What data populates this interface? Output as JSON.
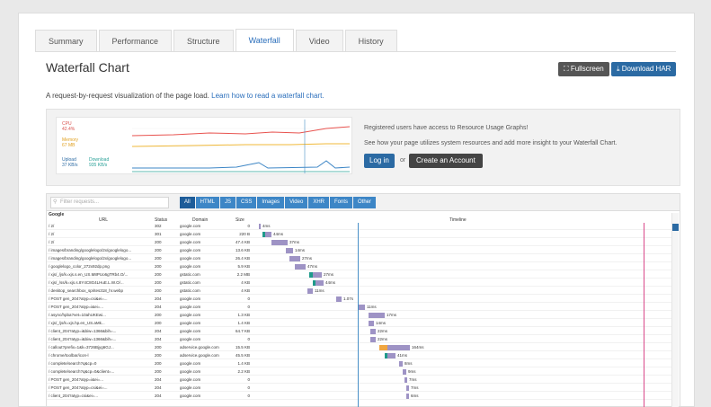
{
  "tabs": [
    {
      "label": "Summary",
      "active": false
    },
    {
      "label": "Performance",
      "active": false
    },
    {
      "label": "Structure",
      "active": false
    },
    {
      "label": "Waterfall",
      "active": true
    },
    {
      "label": "Video",
      "active": false
    },
    {
      "label": "History",
      "active": false
    }
  ],
  "header": {
    "title": "Waterfall Chart",
    "fullscreen_label": "⛶ Fullscreen",
    "download_label": "⤓ Download HAR",
    "subtitle": "A request-by-request visualization of the page load.",
    "subtitle_link": "Learn how to read a waterfall chart."
  },
  "usage_chart": {
    "cpu_label": "CPU",
    "cpu_value": "42.4%",
    "memory_label": "Memory",
    "memory_value": "67 MB",
    "upload_label": "Upload",
    "upload_value": "37 KB/s",
    "download_label": "Download",
    "download_value": "935 KB/s"
  },
  "promo": {
    "line1": "Registered users have access to Resource Usage Graphs!",
    "line2": "See how your page utilizes system resources and add more insight to your Waterfall Chart.",
    "login_label": "Log in",
    "or_label": "or",
    "create_label": "Create an Account"
  },
  "filter": {
    "placeholder": "Filter requests...",
    "chips": [
      "All",
      "HTML",
      "JS",
      "CSS",
      "Images",
      "Video",
      "XHR",
      "Fonts",
      "Other"
    ]
  },
  "table": {
    "group": "Google",
    "columns": {
      "url": "URL",
      "status": "Status",
      "domain": "Domain",
      "size": "Size",
      "timeline": "Timeline"
    },
    "rows": [
      {
        "url": "/ 2/",
        "status": "302",
        "domain": "google.com",
        "size": "0",
        "bar": "4ms"
      },
      {
        "url": "/ 2/",
        "status": "301",
        "domain": "google.com",
        "size": "220 B",
        "bar": "44ms"
      },
      {
        "url": "/ 2/",
        "status": "200",
        "domain": "google.com",
        "size": "47.4 KB",
        "bar": "37ms"
      },
      {
        "url": "/ images/branding/googlelogo/2x/googlelogo...",
        "status": "200",
        "domain": "google.com",
        "size": "13.6 KB",
        "bar": "14ms"
      },
      {
        "url": "/ images/branding/googlelogo/2x/googlelogo...",
        "status": "200",
        "domain": "google.com",
        "size": "26.4 KB",
        "bar": "27ms"
      },
      {
        "url": "/ googlelogo_color_272x92dp.png",
        "status": "200",
        "domain": "google.com",
        "size": "5.9 KB",
        "bar": "47ms"
      },
      {
        "url": "/ xjs/_/js/k=xjs.s.en_US.M8PUo6gTRb4.O/...",
        "status": "200",
        "domain": "gstatic.com",
        "size": "2.2 MB",
        "bar": "27ms"
      },
      {
        "url": "/ xjs/_/ss/k=xjs.s.8Y4C8G4LHuE.L.W.O/...",
        "status": "200",
        "domain": "gstatic.com",
        "size": "4 KB",
        "bar": "44ms"
      },
      {
        "url": "/ desktop_searchbox_sprites318_hr.webp",
        "status": "200",
        "domain": "gstatic.com",
        "size": "4 KB",
        "bar": "11ms"
      },
      {
        "url": "/ POST gen_204?atyp=csi&ei=...",
        "status": "204",
        "domain": "google.com",
        "size": "0",
        "bar": "1.07s"
      },
      {
        "url": "/ POST gen_204?atyp=i&ei=...",
        "status": "204",
        "domain": "google.com",
        "size": "0",
        "bar": "11ms"
      },
      {
        "url": "/ async/hpba?vet=10ahUKEwi...",
        "status": "200",
        "domain": "google.com",
        "size": "1.3 KB",
        "bar": "17ms"
      },
      {
        "url": "/ xjs/_/js/k=xjs.hp.en_US.aMk...",
        "status": "200",
        "domain": "google.com",
        "size": "1.4 KB",
        "bar": "14ms"
      },
      {
        "url": "/ client_204?atyp=i&biw=1366&bih=...",
        "status": "204",
        "domain": "google.com",
        "size": "64.7 KB",
        "bar": "22ms"
      },
      {
        "url": "/ client_204?atyp=i&biw=1366&bih=...",
        "status": "204",
        "domain": "google.com",
        "size": "0",
        "bar": "22ms"
      },
      {
        "url": "/ callout?prefix=1&k=3726Bjyg6GJ...",
        "status": "200",
        "domain": "adservice.google.com",
        "size": "15.5 KB",
        "bar": "164ms"
      },
      {
        "url": "/ chrome/toolbar/icon-l",
        "status": "200",
        "domain": "adservice.google.com",
        "size": "45.5 KB",
        "bar": "41ms"
      },
      {
        "url": "/ complete/search?q&cp=0",
        "status": "200",
        "domain": "google.com",
        "size": "1.4 KB",
        "bar": "8ms"
      },
      {
        "url": "/ complete/search?q&cp=0&client=...",
        "status": "200",
        "domain": "google.com",
        "size": "2.2 KB",
        "bar": "9ms"
      },
      {
        "url": "/ POST gen_204?atyp=i&ei=...",
        "status": "204",
        "domain": "google.com",
        "size": "0",
        "bar": "7ms"
      },
      {
        "url": "/ POST gen_204?atyp=csi&ei=...",
        "status": "204",
        "domain": "google.com",
        "size": "0",
        "bar": "7ms"
      },
      {
        "url": "/ client_204?atyp=csi&ei=...",
        "status": "204",
        "domain": "google.com",
        "size": "0",
        "bar": "6ms"
      }
    ]
  },
  "colors": {
    "accent": "#2b6aa3",
    "chip": "#3d86c6",
    "bar_wait": "#9e93c5",
    "bar_dns": "#1e9a8a",
    "bar_connect": "#f0a640",
    "bar_ssl": "#5b9ad5",
    "bar_receive": "#8aa66a",
    "dom_line": "#4a90c7",
    "onload_line": "#d9498a"
  }
}
